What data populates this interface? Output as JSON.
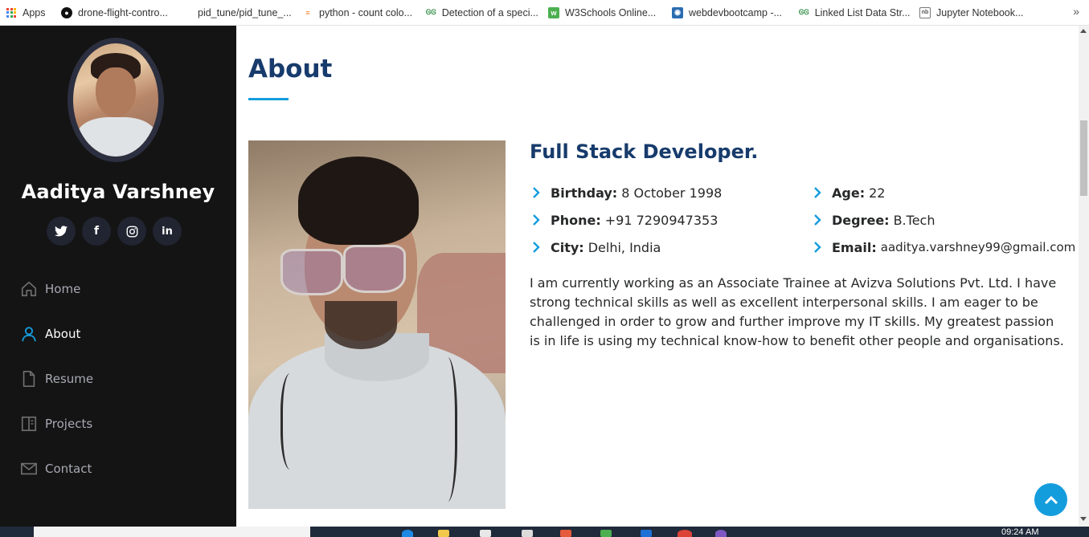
{
  "bookmarks": [
    {
      "label": "Apps",
      "icon": "apps-grid-icon"
    },
    {
      "label": "drone-flight-contro...",
      "icon": "github-icon"
    },
    {
      "label": "pid_tune/pid_tune_...",
      "icon": "blank-page-icon"
    },
    {
      "label": "python - count colo...",
      "icon": "stackoverflow-icon"
    },
    {
      "label": "Detection of a speci...",
      "icon": "geeksforgeeks-icon"
    },
    {
      "label": "W3Schools Online...",
      "icon": "w3schools-icon"
    },
    {
      "label": "webdevbootcamp -...",
      "icon": "bootcamp-icon"
    },
    {
      "label": "Linked List Data Str...",
      "icon": "geeksforgeeks-icon"
    },
    {
      "label": "Jupyter Notebook...",
      "icon": "jupyter-icon"
    }
  ],
  "bookmarks_more": "»",
  "profile": {
    "name": "Aaditya Varshney",
    "socials": [
      {
        "name": "twitter",
        "glyph": "🐦"
      },
      {
        "name": "facebook",
        "glyph": "f"
      },
      {
        "name": "instagram",
        "glyph": "◎"
      },
      {
        "name": "linkedin",
        "glyph": "in"
      }
    ]
  },
  "nav": {
    "home": "Home",
    "about": "About",
    "resume": "Resume",
    "projects": "Projects",
    "contact": "Contact"
  },
  "about": {
    "title": "About",
    "role": "Full Stack Developer.",
    "left_info": [
      {
        "label": "Birthday:",
        "value": "8 October 1998"
      },
      {
        "label": "Phone:",
        "value": "+91 7290947353"
      },
      {
        "label": "City:",
        "value": "Delhi, India"
      }
    ],
    "right_info": [
      {
        "label": "Age:",
        "value": "22"
      },
      {
        "label": "Degree:",
        "value": "B.Tech"
      },
      {
        "label": "Email:",
        "value": "aaditya.varshney99@gmail.com"
      }
    ],
    "description": "I am currently working as an Associate Trainee at Avizva Solutions Pvt. Ltd. I have strong technical skills as well as excellent interpersonal skills. I am eager to be challenged in order to grow and further improve my IT skills. My greatest passion is in life is using my technical know-how to benefit other people and organisations."
  },
  "taskbar": {
    "time": "09:24 AM"
  },
  "colors": {
    "accent": "#149ddd",
    "heading": "#173b6c",
    "sidebar": "#141414"
  }
}
